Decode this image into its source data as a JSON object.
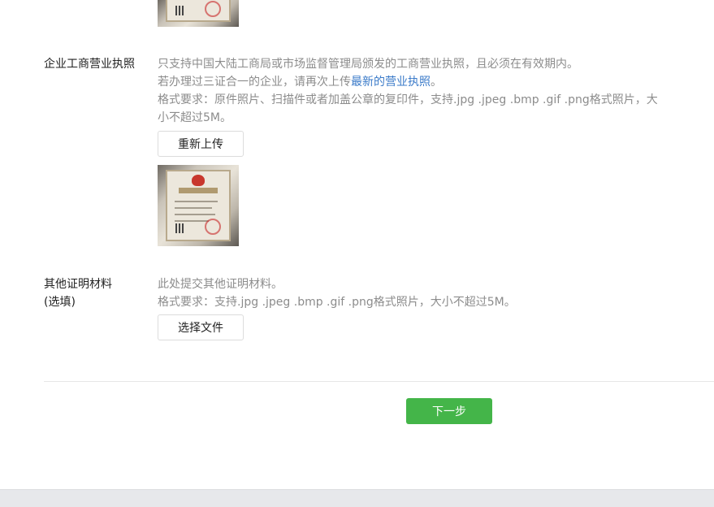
{
  "license_section": {
    "label": "企业工商营业执照",
    "desc_line1": "只支持中国大陆工商局或市场监督管理局颁发的工商营业执照，且必须在有效期内。",
    "desc_line2_prefix": "若办理过三证合一的企业，请再次上传",
    "desc_line2_link": "最新的营业执照",
    "desc_line2_suffix": "。",
    "desc_line3": "格式要求：原件照片、扫描件或者加盖公章的复印件，支持.jpg .jpeg .bmp .gif .png格式照片，大",
    "desc_line4": "小不超过5M。",
    "reupload_label": "重新上传"
  },
  "other_section": {
    "label_line1": "其他证明材料",
    "label_line2": "(选填)",
    "desc_line1": "此处提交其他证明材料。",
    "desc_line2": "格式要求：支持.jpg .jpeg .bmp .gif .png格式照片，大小不超过5M。",
    "choose_file_label": "选择文件"
  },
  "actions": {
    "next_label": "下一步"
  },
  "colors": {
    "accent_green": "#44b549",
    "link_blue": "#3b7bc9"
  }
}
